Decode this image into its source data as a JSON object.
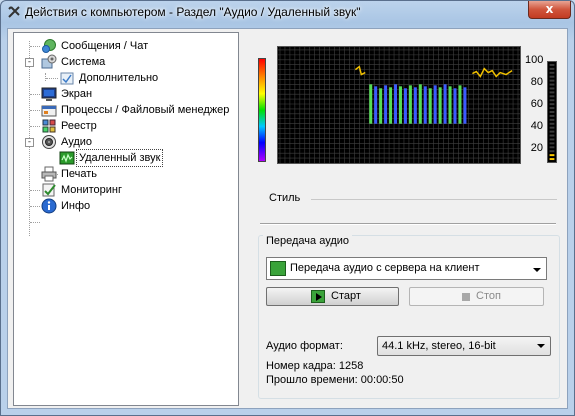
{
  "window": {
    "title": "Действия с компьютером - Раздел \"Аудио / Удаленный звук\"",
    "close_label": "x"
  },
  "tree": {
    "items": [
      {
        "label": "Сообщения / Чат",
        "icon": "chat-icon",
        "level": 0
      },
      {
        "label": "Система",
        "icon": "system-gear-icon",
        "level": 0,
        "expander": "-"
      },
      {
        "label": "Дополнительно",
        "icon": "additional-icon",
        "level": 1
      },
      {
        "label": "Экран",
        "icon": "monitor-icon",
        "level": 0
      },
      {
        "label": "Процессы / Файловый менеджер",
        "icon": "processes-icon",
        "level": 0
      },
      {
        "label": "Реестр",
        "icon": "registry-icon",
        "level": 0
      },
      {
        "label": "Аудио",
        "icon": "audio-icon",
        "level": 0,
        "expander": "-"
      },
      {
        "label": "Удаленный звук",
        "icon": "remote-sound-icon",
        "level": 1,
        "selected": true
      },
      {
        "label": "Печать",
        "icon": "printer-icon",
        "level": 0
      },
      {
        "label": "Мониторинг",
        "icon": "monitoring-icon",
        "level": 0
      },
      {
        "label": "Инфо",
        "icon": "info-icon",
        "level": 0
      }
    ]
  },
  "visualizer": {
    "scale_labels": [
      "100",
      "80",
      "60",
      "40",
      "20"
    ],
    "style_label": "Стиль"
  },
  "transfer": {
    "group_label": "Передача аудио",
    "source_value": "Передача аудио с сервера на клиент",
    "start_label": "Старт",
    "stop_label": "Стоп",
    "format_label": "Аудио формат:",
    "format_value": "44.1 kHz, stereo, 16-bit",
    "frame_label": "Номер кадра: 1258",
    "elapsed_label": "Прошло времени: 00:00:50"
  },
  "colors": {
    "spectrum_bars": "#3b5bff",
    "spectrum_green": "#55dd55",
    "spectrum_peaks": "#f0c000",
    "grid": "#404040",
    "level_meter": "#ffcc00"
  }
}
